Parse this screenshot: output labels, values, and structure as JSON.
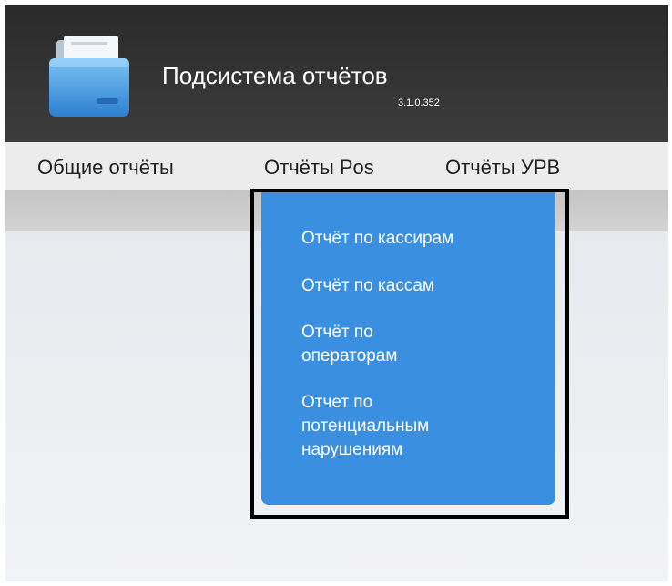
{
  "header": {
    "title": "Подсистема отчётов",
    "version": "3.1.0.352",
    "icon": "folder-icon",
    "colors": {
      "background": "#333333",
      "icon_accent": "#4ea3e6"
    }
  },
  "nav": {
    "items": [
      {
        "label": "Общие отчёты"
      },
      {
        "label": "Отчёты Pos"
      },
      {
        "label": "Отчёты УРВ"
      }
    ]
  },
  "dropdown": {
    "items": [
      {
        "label": "Отчёт по кассирам"
      },
      {
        "label": "Отчёт по кассам"
      },
      {
        "label": "Отчёт по операторам"
      },
      {
        "label": "Отчет по потенциальным нарушениям"
      }
    ],
    "colors": {
      "background": "#3a8fe0",
      "highlight_border": "#000000"
    }
  }
}
